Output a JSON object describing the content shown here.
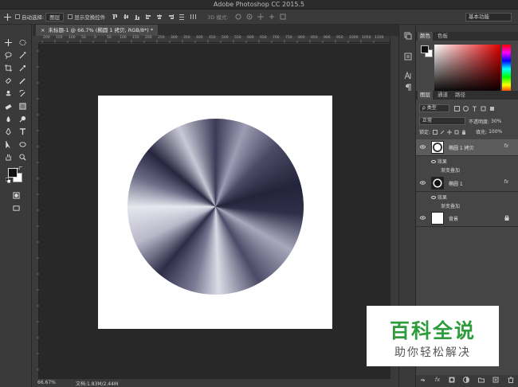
{
  "window": {
    "title": "Adobe Photoshop CC 2015.5"
  },
  "options_bar": {
    "auto_select_label": "自动选择:",
    "auto_select_value": "图层",
    "show_transform_label": "显示变换控件",
    "mode_3d_label": "3D 模式:",
    "workspace": "基本功能"
  },
  "document_tab": {
    "title": "未标题-1 @ 66.7% (椭圆 1 拷贝, RGB/8*) *",
    "close": "×"
  },
  "ruler": {
    "marks": [
      "200",
      "150",
      "100",
      "50",
      "0",
      "50",
      "100",
      "150",
      "200",
      "250",
      "300",
      "350",
      "400",
      "450",
      "500",
      "550",
      "600",
      "650",
      "700",
      "750",
      "800",
      "850",
      "900",
      "950",
      "1000",
      "1050",
      "1100"
    ]
  },
  "status_bar": {
    "zoom": "66.67%",
    "doc_info": "文档:1.83M/2.44M"
  },
  "color_panel": {
    "tabs": [
      "颜色",
      "色板"
    ]
  },
  "layers_panel": {
    "tabs": [
      "图层",
      "通道",
      "路径"
    ],
    "filter_label": "ρ 类型",
    "blend_mode": "正常",
    "opacity_label": "不透明度:",
    "opacity_value": "30%",
    "lock_label": "锁定:",
    "fill_label": "填充:",
    "fill_value": "100%",
    "layers": [
      {
        "name": "椭圆 1 拷贝",
        "fx": "fx",
        "effects_label": "效果",
        "effect": "渐变叠加"
      },
      {
        "name": "椭圆 1",
        "fx": "fx",
        "effects_label": "效果",
        "effect": "渐变叠加"
      },
      {
        "name": "背景",
        "lock": "🔒"
      }
    ],
    "bottom_icons": [
      "link-icon",
      "fx-icon",
      "mask-icon",
      "adjustment-icon",
      "group-icon",
      "new-layer-icon",
      "trash-icon"
    ]
  },
  "watermark": {
    "main": "百科全说",
    "sub": "助你轻松解决"
  },
  "colors": {
    "watermark_green": "#2e9b3c",
    "accent_red": "#e10000"
  }
}
